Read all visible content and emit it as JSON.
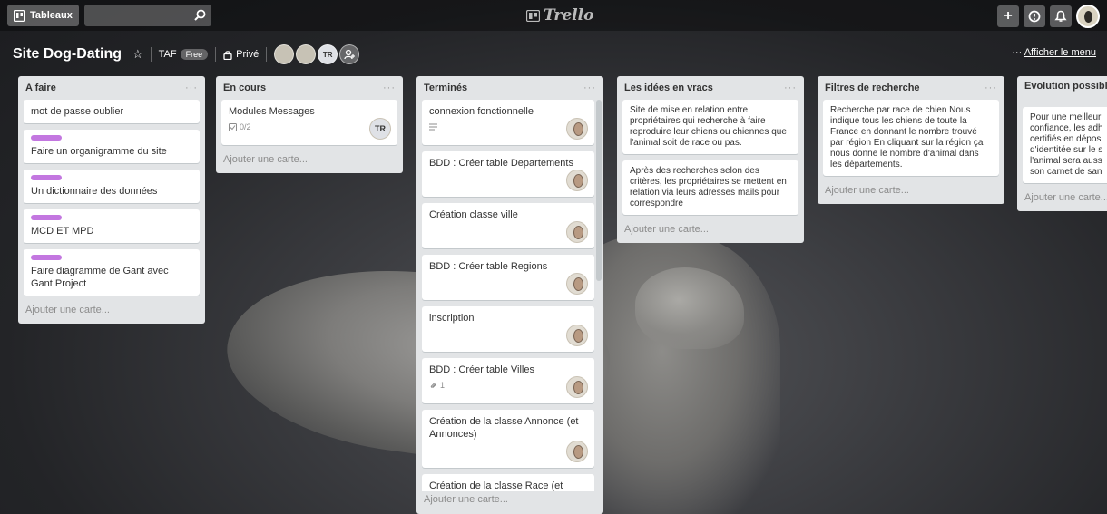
{
  "topbar": {
    "boards_label": "Tableaux",
    "search_placeholder": "",
    "logo_text": "Trello",
    "create_symbol": "+"
  },
  "board": {
    "title": "Site Dog-Dating",
    "team": "TAF",
    "team_badge": "Free",
    "visibility": "Privé",
    "member_initials": "TR",
    "menu_label": "Afficher le menu",
    "menu_dots": "···"
  },
  "colors": {
    "label_purple": "#c377e0",
    "list_bg": "#e2e4e6"
  },
  "lists": [
    {
      "title": "A faire",
      "cards": [
        {
          "text": "mot de passe oublier",
          "label": false
        },
        {
          "text": "Faire un organigramme du site",
          "label": true
        },
        {
          "text": "Un dictionnaire des données",
          "label": true
        },
        {
          "text": "MCD ET MPD",
          "label": true
        },
        {
          "text": "Faire diagramme de Gant avec Gant Project",
          "label": true
        }
      ],
      "add_card": "Ajouter une carte..."
    },
    {
      "title": "En cours",
      "cards": [
        {
          "text": "Modules Messages",
          "checklist": "0/2",
          "member": "TR"
        }
      ],
      "add_card": "Ajouter une carte..."
    },
    {
      "title": "Terminés",
      "cards": [
        {
          "text": "connexion fonctionnelle",
          "description_icon": "description-icon"
        },
        {
          "text": "BDD : Créer table Departements"
        },
        {
          "text": "Création classe ville"
        },
        {
          "text": "BDD : Créer table Regions"
        },
        {
          "text": "inscription"
        },
        {
          "text": "BDD : Créer table Villes",
          "attachments": "1"
        },
        {
          "text": "Création de la classe Annonce (et Annonces)"
        },
        {
          "text": "Création de la classe Race (et Race)"
        }
      ],
      "add_card": "Ajouter une carte..."
    },
    {
      "title": "Les idées en vracs",
      "cards": [
        {
          "text": "Site de mise en relation entre propriétaires qui recherche à faire reproduire leur chiens ou chiennes que l'animal soit de race ou pas."
        },
        {
          "text": "Après des recherches selon des critères, les propriétaires se mettent en relation via leurs adresses mails pour correspondre"
        }
      ],
      "add_card": "Ajouter une carte..."
    },
    {
      "title": "Filtres de recherche",
      "cards": [
        {
          "text": "Recherche par race de chien Nous indique tous les chiens de toute la France en donnant le nombre trouvé par région En cliquant sur la région ça nous donne le nombre d'animal dans les départements."
        }
      ],
      "add_card": "Ajouter une carte..."
    },
    {
      "title": "Evolution possible dans le temps",
      "title_visible": "Evolution possibl temps",
      "cards": [
        {
          "text": "Pour une meilleur confiance, les adh certifiés en dépos d'identitée sur le s l'animal sera auss son carnet de san"
        }
      ],
      "add_card": "Ajouter une carte..."
    }
  ]
}
